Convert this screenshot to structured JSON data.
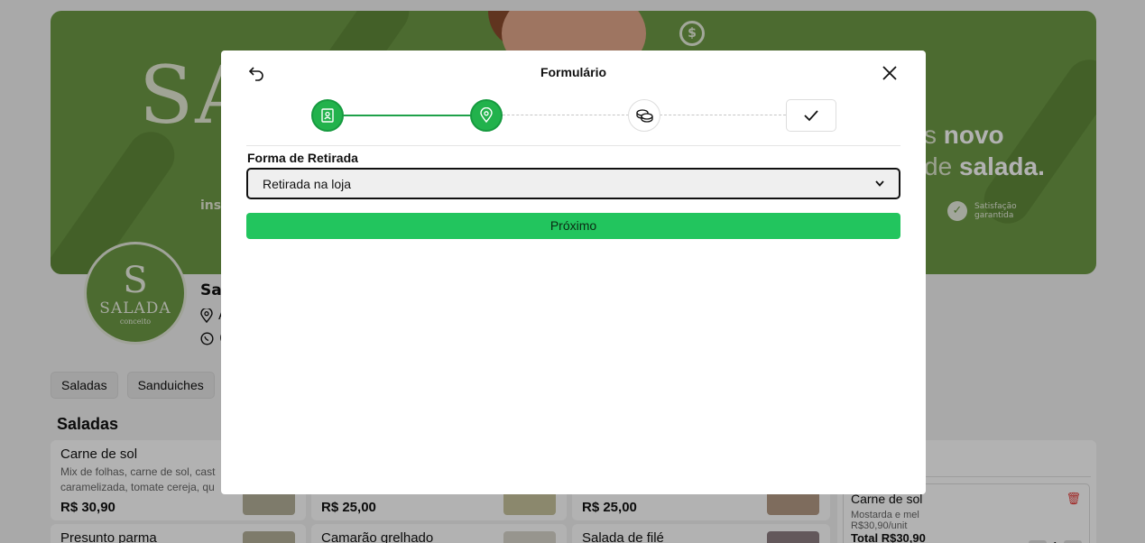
{
  "banner": {
    "big_text": "SA",
    "promo_line1_light": "s ",
    "promo_line1_bold": "novo",
    "promo_line2_light": "de ",
    "promo_line2_bold": "salada.",
    "left_text": "inst",
    "guarantee_line1": "Satisfação",
    "guarantee_line2": "garantida",
    "badge_icon": "refresh-dollar-icon"
  },
  "logo": {
    "monogram": "S",
    "name": "SALADA",
    "sub": "conceito"
  },
  "store": {
    "name": "Sal",
    "address_initial": "A",
    "phone_initial": "("
  },
  "categories": [
    "Saladas",
    "Sanduiches",
    ""
  ],
  "section_title": "Saladas",
  "products": [
    {
      "name": "Carne de sol",
      "desc": "Mix de folhas, carne de sol, cast caramelizada, tomate cereja, qu",
      "price": "R$ 30,90"
    },
    {
      "name": "",
      "desc": "",
      "price": "R$ 25,00"
    },
    {
      "name": "",
      "desc": "",
      "price": "R$ 25,00"
    },
    {
      "name": "Presunto parma",
      "desc": "",
      "price": ""
    },
    {
      "name": "Camarão grelhado",
      "desc": "",
      "price": ""
    },
    {
      "name": "Salada de filé",
      "desc": "",
      "price": ""
    }
  ],
  "cart": {
    "item_name": "Carne de sol",
    "item_note": "Mostarda e mel",
    "item_unit": "R$30,90/unit",
    "item_total": "Total R$30,90",
    "qty": "1"
  },
  "modal": {
    "title": "Formulário",
    "steps": [
      {
        "icon": "id-card-icon",
        "state": "done"
      },
      {
        "icon": "location-pin-icon",
        "state": "done"
      },
      {
        "icon": "coins-icon",
        "state": "pending"
      },
      {
        "icon": "checkmark-icon",
        "state": "pending"
      }
    ],
    "field_label": "Forma de Retirada",
    "select_value": "Retirada na loja",
    "next_label": "Próximo"
  },
  "colors": {
    "brand_green": "#6e9a45",
    "step_green": "#22b24c",
    "button_green": "#22c55e"
  }
}
